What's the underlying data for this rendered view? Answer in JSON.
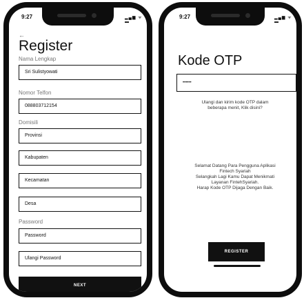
{
  "register_screen": {
    "status": {
      "time": "9:27",
      "icons": "▂▄▆ ᯤ ▬"
    },
    "back_icon": "←",
    "title": "Register",
    "nama": {
      "label": "Nama Lengkap",
      "value": "Sri Sulistyowati"
    },
    "telfon": {
      "label": "Nomor Telfon",
      "value": "088803712154"
    },
    "domisili": {
      "label": "Domisili",
      "fields": [
        "Provinsi",
        "Kabupaten",
        "Kecamatan",
        "Desa"
      ]
    },
    "password": {
      "label": "Password",
      "field": "Password",
      "confirm_field": "Ulangi Password"
    },
    "next_label": "NEXT"
  },
  "otp_screen": {
    "status": {
      "time": "9:27",
      "icons": "▂▄▆ ᯤ ▬"
    },
    "title": "Kode OTP",
    "otp_value": "••••••",
    "resend_line1": "Ulangi dan kirim kode OTP dalam",
    "resend_line2": "beberapa menit, Klik disini?",
    "welcome_lines": [
      "Selamat Datang Para Pengguna Aplikasi",
      "Fintech Syariah",
      "Selangkah Lagi Kamu Dapat Menikmati",
      "Layanan FintehSyariah.",
      "Harap Kode OTP Dijaga Dengan Baik."
    ],
    "register_label": "REGISTER"
  }
}
